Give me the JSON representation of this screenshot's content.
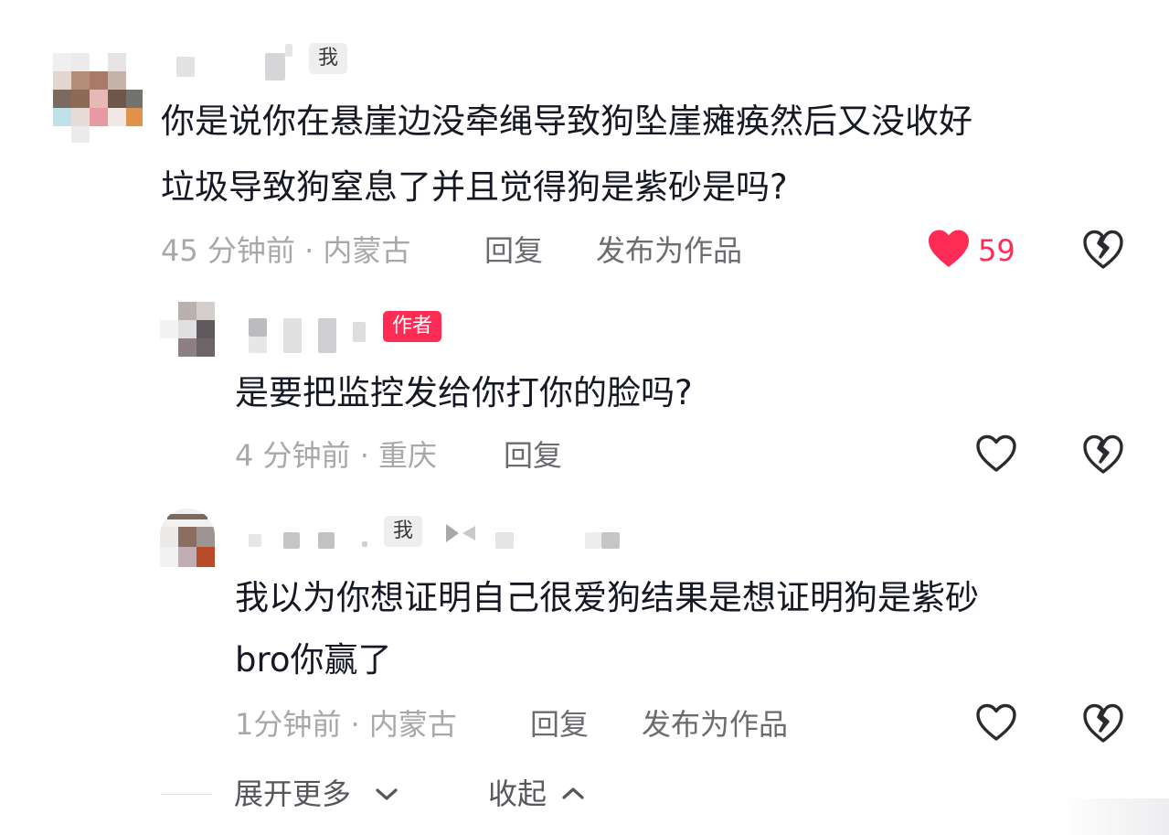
{
  "comments": [
    {
      "tag": "我",
      "text_lines": [
        "你是说你在悬崖边没牵绳导致狗坠崖瘫痪然后又没收好",
        "垃圾导致狗窒息了并且觉得狗是紫砂是吗?"
      ],
      "time_location": "45 分钟前 · 内蒙古",
      "reply_label": "回复",
      "publish_label": "发布为作品",
      "like_count": "59",
      "liked": true
    },
    {
      "tag": "作者",
      "text_lines": [
        "是要把监控发给你打你的脸吗?"
      ],
      "time_location": "4 分钟前 · 重庆",
      "reply_label": "回复",
      "liked": false
    },
    {
      "tag": "我",
      "text_lines": [
        "我以为你想证明自己很爱狗结果是想证明狗是紫砂",
        "bro你赢了"
      ],
      "time_location": "1分钟前 · 内蒙古",
      "reply_label": "回复",
      "publish_label": "发布为作品",
      "liked": false
    }
  ],
  "footer": {
    "expand_more": "展开更多",
    "collapse": "收起"
  },
  "colors": {
    "accent": "#fe2c55",
    "text": "#161823",
    "meta": "#a8a8ab"
  }
}
